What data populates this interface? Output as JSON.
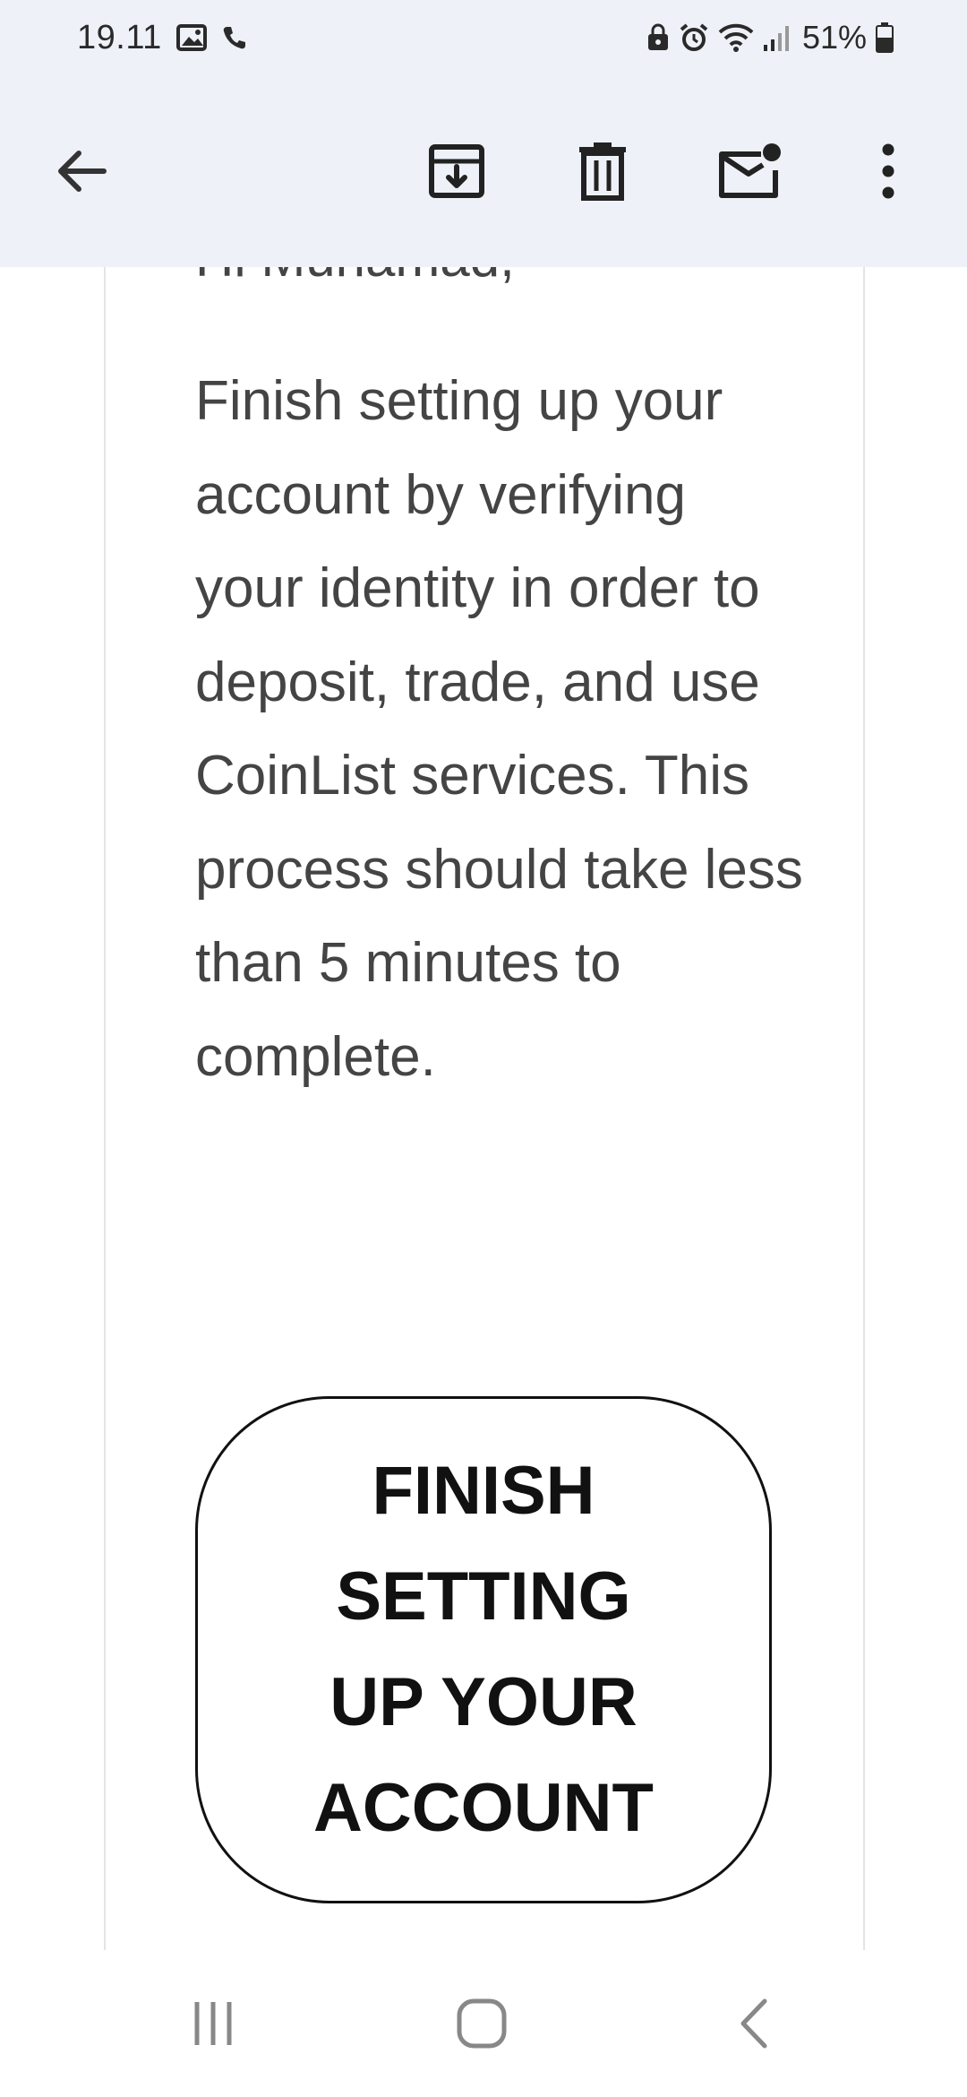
{
  "status_bar": {
    "time": "19.11",
    "battery_percent": "51%",
    "left_icons": [
      "gallery-icon",
      "phone-call-icon"
    ],
    "right_icons": [
      "lock-icon",
      "alarm-icon",
      "wifi-icon",
      "signal-icon",
      "battery-icon"
    ]
  },
  "toolbar": {
    "icons": [
      "back-arrow-icon",
      "archive-icon",
      "delete-icon",
      "mark-unread-icon",
      "more-options-icon"
    ]
  },
  "email": {
    "greeting": "Hi Muhamad,",
    "body": "Finish setting up your account by verifying your identity in order to deposit, trade, and use CoinList services. This process should take less than 5 minutes to complete.",
    "cta_label": "FINISH SETTING UP YOUR ACCOUNT"
  },
  "nav_bar": {
    "icons": [
      "recent-apps-icon",
      "home-icon",
      "nav-back-icon"
    ]
  },
  "colors": {
    "toolbar_bg": "#eef1f7",
    "body_text": "#444444",
    "cta_border": "#111111"
  }
}
